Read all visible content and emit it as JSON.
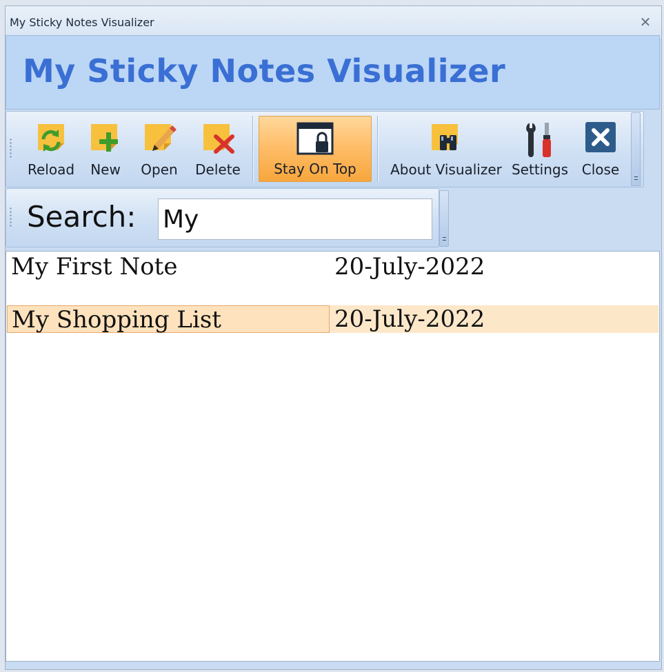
{
  "window": {
    "title": "My Sticky Notes Visualizer",
    "close_glyph": "✕"
  },
  "banner": {
    "title": "My Sticky Notes Visualizer",
    "color": "#3a6fd4"
  },
  "toolbar": {
    "reload": {
      "label": "Reload",
      "icon": "note-reload-icon"
    },
    "new": {
      "label": "New",
      "icon": "note-add-icon"
    },
    "open": {
      "label": "Open",
      "icon": "note-edit-icon"
    },
    "delete": {
      "label": "Delete",
      "icon": "note-delete-icon"
    },
    "stay_on_top": {
      "label": "Stay On Top",
      "icon": "window-lock-icon",
      "active": true
    },
    "about": {
      "label": "About Visualizer",
      "icon": "note-binoculars-icon"
    },
    "settings": {
      "label": "Settings",
      "icon": "tools-icon"
    },
    "close": {
      "label": "Close",
      "icon": "close-box-icon"
    }
  },
  "search": {
    "label": "Search:",
    "value": "My"
  },
  "notes": [
    {
      "title": "My First Note",
      "date": "20-July-2022",
      "selected": false
    },
    {
      "title": "My Shopping List",
      "date": "20-July-2022",
      "selected": true
    }
  ]
}
